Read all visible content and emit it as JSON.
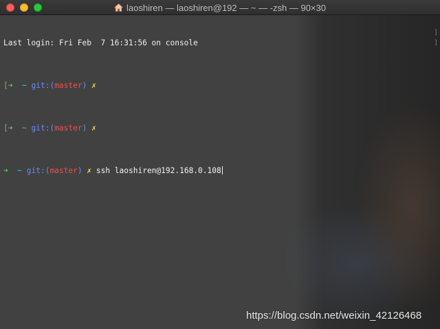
{
  "window": {
    "title": "laoshiren — laoshiren@192 — ~ — -zsh — 90×30",
    "title_icon": "home-icon",
    "traffic_lights": [
      "close",
      "minimize",
      "maximize"
    ],
    "colors": {
      "background": "#3f3f3f",
      "prompt_arrow": "#4fd14f",
      "tilde": "#35c9d6",
      "git_label": "#6a8cf5",
      "branch": "#f04e4e",
      "dirty_mark": "#f2e14b"
    }
  },
  "terminal": {
    "last_login": "Last login: Fri Feb  7 16:31:56 on console",
    "prompt": {
      "arrow": "➜",
      "dir": "~",
      "git_prefix": "git:",
      "open_paren": "(",
      "branch": "master",
      "close_paren": ")",
      "dirty": "✗"
    },
    "lines": [
      {
        "bracket": "[",
        "command": ""
      },
      {
        "bracket": "[",
        "command": ""
      },
      {
        "bracket": "",
        "command": "ssh laoshiren@192.168.0.108"
      }
    ],
    "right_marks": [
      "]",
      "]"
    ]
  },
  "watermark": "https://blog.csdn.net/weixin_42126468"
}
